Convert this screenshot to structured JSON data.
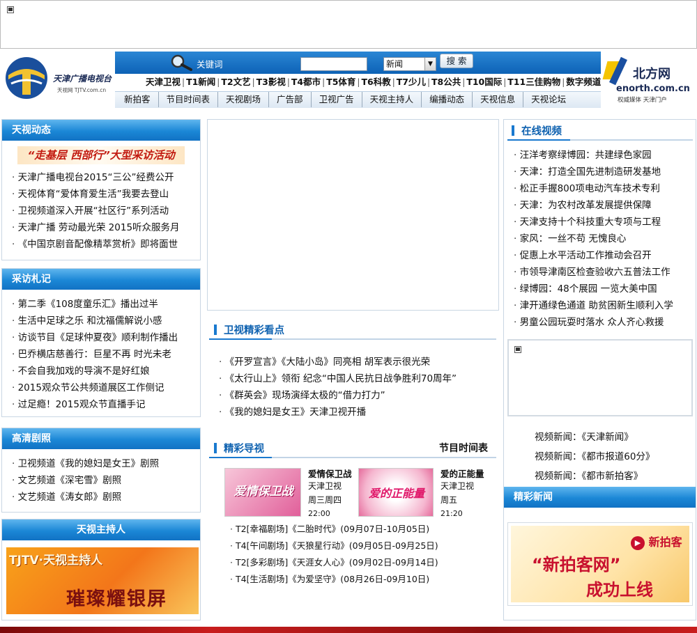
{
  "search": {
    "keyword_label": "关键词",
    "input_value": "",
    "category_selected": "新闻",
    "button_label": "搜 索"
  },
  "logo": {
    "name": "天津广播电视台",
    "subtitle": "天视网 TJTV.com.cn"
  },
  "enorth": {
    "name": "北方网",
    "domain": "enorth.com.cn",
    "tagline": "权威媒体 天津门户"
  },
  "channels": [
    "天津卫视",
    "T1新闻",
    "T2文艺",
    "T3影视",
    "T4都市",
    "T5体育",
    "T6科教",
    "T7少儿",
    "T8公共",
    "T10国际",
    "T11三佳购物",
    "数字频道"
  ],
  "nav": [
    "新拍客",
    "节目时间表",
    "天视剧场",
    "广告部",
    "卫视广告",
    "天视主持人",
    "编播动态",
    "天视信息",
    "天视论坛"
  ],
  "dongtai": {
    "title": "天视动态",
    "banner": "“走基层 西部行”大型采访活动",
    "items": [
      "天津广播电视台2015“三公”经费公开",
      "天视体育“爱体育爱生活”我要去登山",
      "卫视频道深入开展“社区行”系列活动",
      "天津广播 劳动最光荣 2015听众服务月",
      "《中国京剧音配像精萃赏析》即将面世"
    ]
  },
  "zhaji": {
    "title": "采访札记",
    "items": [
      "第二季《108度童乐汇》播出过半",
      "生活中足球之乐 和沈福儒解说小感",
      "访谈节目《足球仲夏夜》顺利制作播出",
      "巴乔横店慈善行：巨星不再 时光未老",
      "不会自我加戏的导演不是好红娘",
      "2015观众节公共频道展区工作侧记",
      "过足瘾！2015观众节直播手记"
    ]
  },
  "juzhao": {
    "title": "高清剧照",
    "items": [
      "卫视频道《我的媳妇是女王》剧照",
      "文艺频道《深宅雪》剧照",
      "文艺频道《涛女郎》剧照"
    ]
  },
  "host": {
    "title": "天视主持人",
    "banner_top": "TJTV·天视主持人",
    "banner_bottom": "璀璨耀银屏"
  },
  "weishi": {
    "title": "卫视精彩看点",
    "items": [
      "《开罗宣言》《大陆小岛》同亮相 胡军表示很光荣",
      "《太行山上》领衔 纪念“中国人民抗日战争胜利70周年”",
      "《群英会》现场演绎太极的“借力打力”",
      "《我的媳妇是女王》天津卫视开播"
    ]
  },
  "daoshi": {
    "title": "精彩导视",
    "schedule_link": "节目时间表",
    "cards": [
      {
        "title": "爱情保卫战",
        "channel": "天津卫视",
        "days": "周三周四",
        "time": "22:00",
        "thumb_text": "爱情保卫战"
      },
      {
        "title": "爱的正能量",
        "channel": "天津卫视",
        "days": "周五",
        "time": "21:20",
        "thumb_text": "爱的正能量"
      }
    ],
    "items": [
      "T2[幸福剧场]《二胎时代》(09月07日-10月05日)",
      "T4[午间剧场]《天狼星行动》(09月05日-09月25日)",
      "T2[多彩剧场]《天涯女人心》(09月02日-09月14日)",
      "T4[生活剧场]《为爱坚守》(08月26日-09月10日)"
    ]
  },
  "video": {
    "title": "在线视频",
    "items": [
      "汪洋考察绿博园：共建绿色家园",
      "天津：打造全国先进制造研发基地",
      "松正手握800项电动汽车技术专利",
      "天津：为农村改革发展提供保障",
      "天津支持十个科技重大专项与工程",
      "家风：一丝不苟 无愧良心",
      "促惠上水平活动工作推动会召开",
      "市领导津南区检查验收六五普法工作",
      "绿博园：48个展园 一览大美中国",
      "津开通绿色通道 助贫困新生顺利入学",
      "男童公园玩耍时落水 众人齐心救援"
    ],
    "news_links": [
      "视频新闻：《天津新闻》",
      "视频新闻：《都市报道60分》",
      "视频新闻：《都市新拍客》"
    ]
  },
  "jingcai": {
    "title": "精彩新闻",
    "banner_main": "“新拍客网”",
    "banner_sub": "成功上线",
    "banner_logo": "新拍客"
  }
}
